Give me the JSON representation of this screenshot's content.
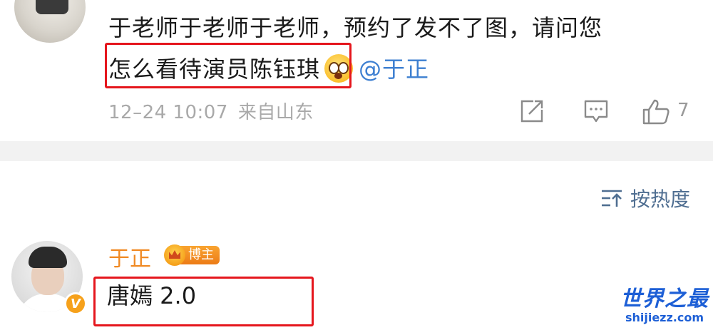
{
  "comment1": {
    "line1": "于老师于老师于老师，预约了发不了图，请问您",
    "line2": "怎么看待演员陈钰琪",
    "mention": "@于正",
    "time": "12–24 10:07",
    "location": "来自山东",
    "like_count": "7"
  },
  "sort": {
    "label": "按热度"
  },
  "comment2": {
    "author": "于正",
    "badge": "博主",
    "text": "唐嫣 2.0",
    "verified_mark": "V"
  },
  "watermark": {
    "title": "世界之最",
    "url": "shijiezz.com"
  },
  "colors": {
    "highlight_box": "#e5161d",
    "mention": "#3d7fd1",
    "author": "#f08a24",
    "meta": "#a9a9a9",
    "watermark": "#1d5fd6"
  }
}
